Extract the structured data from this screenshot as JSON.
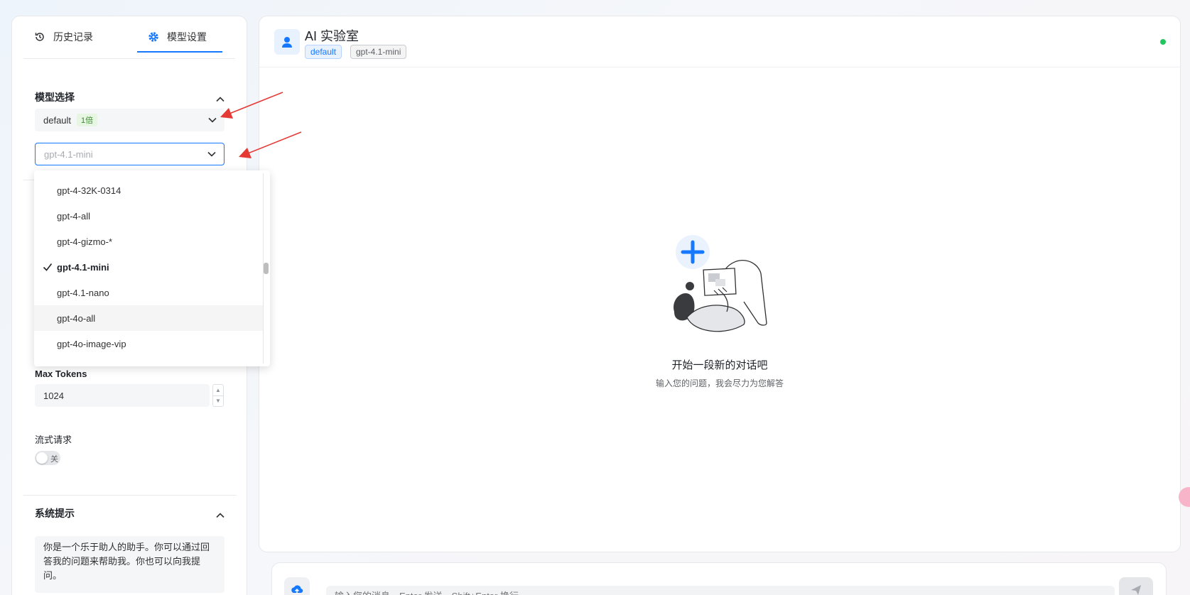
{
  "sidebar": {
    "tabs": [
      {
        "label": "历史记录",
        "icon": "history-icon"
      },
      {
        "label": "模型设置",
        "icon": "gear-icon"
      }
    ],
    "model_section": {
      "title": "模型选择",
      "group_select": {
        "value": "default",
        "badge": "1倍"
      },
      "model_select": {
        "value": "gpt-4.1-mini"
      }
    },
    "max_tokens": {
      "label": "Max Tokens",
      "value": "1024"
    },
    "stream": {
      "label": "流式请求",
      "state_label": "关",
      "enabled": false
    },
    "system_prompt": {
      "title": "系统提示",
      "value": "你是一个乐于助人的助手。你可以通过回答我的问题来帮助我。你也可以向我提问。"
    }
  },
  "dropdown": {
    "options": [
      {
        "label": "gpt-4-32K-0314",
        "selected": false,
        "hover": false
      },
      {
        "label": "gpt-4-all",
        "selected": false,
        "hover": false
      },
      {
        "label": "gpt-4-gizmo-*",
        "selected": false,
        "hover": false
      },
      {
        "label": "gpt-4.1-mini",
        "selected": true,
        "hover": false
      },
      {
        "label": "gpt-4.1-nano",
        "selected": false,
        "hover": false
      },
      {
        "label": "gpt-4o-all",
        "selected": false,
        "hover": true
      },
      {
        "label": "gpt-4o-image-vip",
        "selected": false,
        "hover": false
      }
    ]
  },
  "chat": {
    "title": "AI 实验室",
    "tags": {
      "group": "default",
      "model": "gpt-4.1-mini"
    },
    "status": "online",
    "empty_state": {
      "title": "开始一段新的对话吧",
      "subtitle": "输入您的问题，我会尽力为您解答"
    }
  },
  "composer": {
    "placeholder": "输入您的消息，Enter 发送，Shift+Enter 换行"
  },
  "colors": {
    "accent": "#1677ff",
    "status_online": "#22c55e",
    "annotation_arrow": "#e53935"
  }
}
